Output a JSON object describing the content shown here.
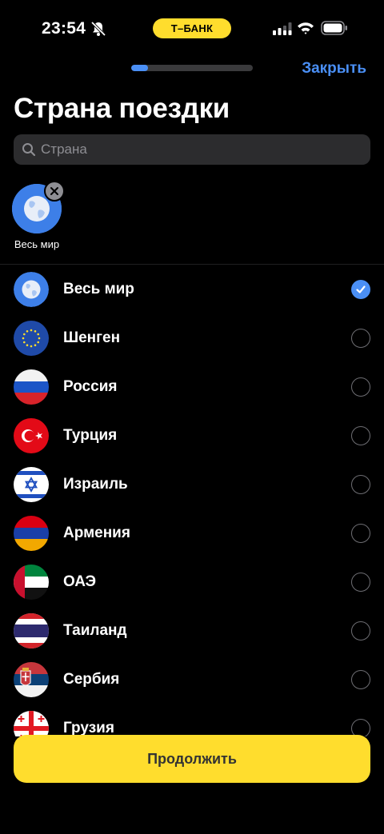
{
  "status_bar": {
    "time": "23:54",
    "bank_label": "Т–БАНК"
  },
  "header": {
    "progress": 0.14,
    "close_label": "Закрыть",
    "title": "Страна поездки"
  },
  "search": {
    "placeholder": "Страна",
    "value": ""
  },
  "selected": [
    {
      "label": "Весь мир",
      "icon": "globe-icon"
    }
  ],
  "countries": [
    {
      "label": "Весь мир",
      "flag": "globe",
      "checked": true
    },
    {
      "label": "Шенген",
      "flag": "eu",
      "checked": false
    },
    {
      "label": "Россия",
      "flag": "russia",
      "checked": false
    },
    {
      "label": "Турция",
      "flag": "turkey",
      "checked": false
    },
    {
      "label": "Израиль",
      "flag": "israel",
      "checked": false
    },
    {
      "label": "Армения",
      "flag": "armenia",
      "checked": false
    },
    {
      "label": "ОАЭ",
      "flag": "uae",
      "checked": false
    },
    {
      "label": "Таиланд",
      "flag": "thailand",
      "checked": false
    },
    {
      "label": "Сербия",
      "flag": "serbia",
      "checked": false
    },
    {
      "label": "Грузия",
      "flag": "georgia",
      "checked": false
    }
  ],
  "continue_label": "Продолжить",
  "colors": {
    "accent": "#4a8ff5",
    "brand_yellow": "#ffdd2d",
    "background": "#000000"
  }
}
